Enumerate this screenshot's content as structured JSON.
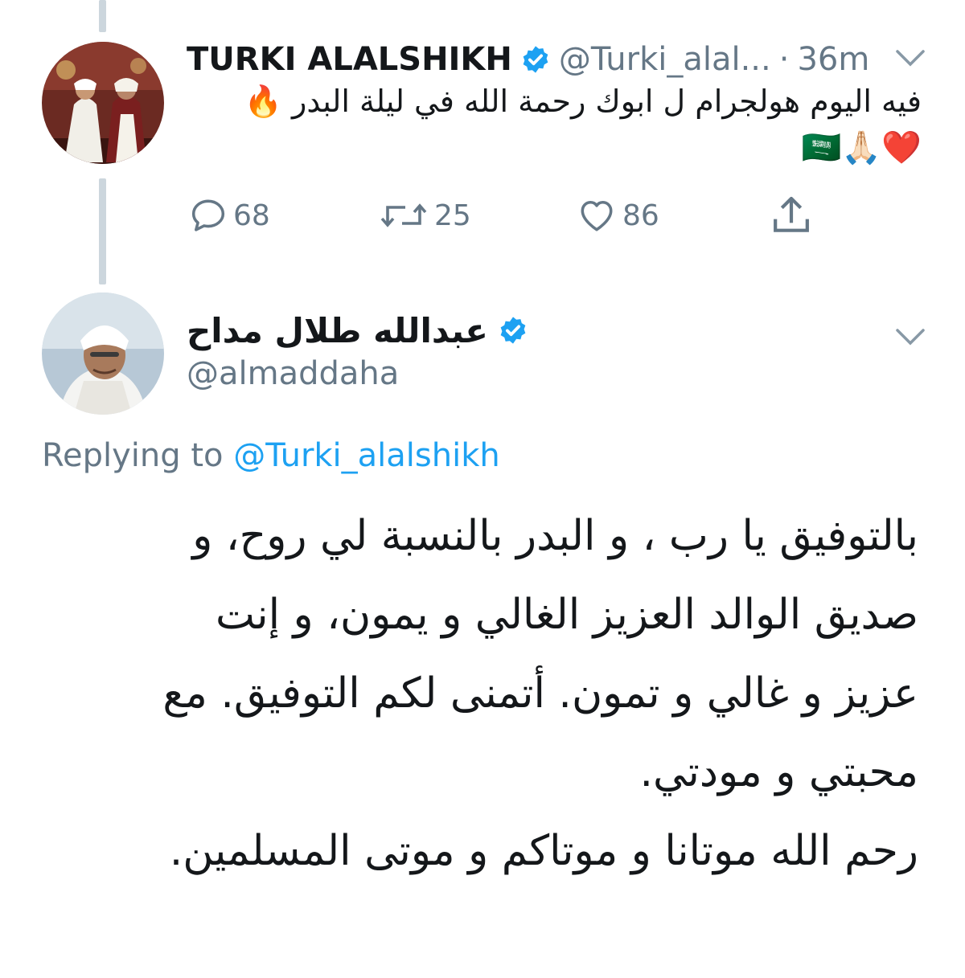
{
  "tweet": {
    "author_name": "TURKI ALALSHIKH",
    "handle": "@Turki_alal...",
    "separator": "·",
    "time": "36m",
    "text": "فيه اليوم هولجرام ل ابوك رحمة الله في ليلة البدر 🔥",
    "emoji_line": "❤️🙏🏻🇸🇦",
    "actions": {
      "replies": "68",
      "retweets": "25",
      "likes": "86"
    }
  },
  "reply": {
    "author_name": "عبدالله طلال مداح",
    "handle": "@almaddaha",
    "replying_prefix": "Replying to",
    "replying_handle": "@Turki_alalshikh",
    "lines": [
      "بالتوفيق يا رب ، و البدر بالنسبة لي روح، و",
      "صديق الوالد العزيز  الغالي و يمون، و إنت",
      "عزيز و غالي و تمون. أتمنى لكم التوفيق. مع",
      "محبتي و مودتي.",
      "رحم الله موتانا و موتاكم و موتى المسلمين."
    ]
  },
  "colors": {
    "text": "#14171a",
    "secondary": "#657786",
    "link": "#1da1f2",
    "verified": "#1da1f2",
    "thread_line": "#ccd6dd"
  },
  "icons": {
    "reply": "reply-icon",
    "retweet": "retweet-icon",
    "like": "heart-icon",
    "share": "share-icon",
    "verified": "verified-badge-icon",
    "menu": "chevron-down-icon"
  }
}
